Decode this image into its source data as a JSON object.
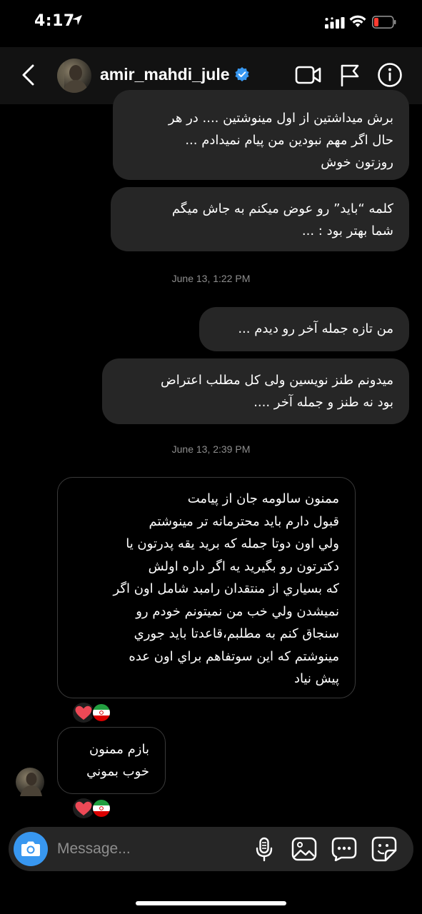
{
  "status_bar": {
    "time": "4:17"
  },
  "header": {
    "username": "amir_mahdi_jule"
  },
  "messages": [
    {
      "lines": [
        "برش میداشتین از اول مینوشتین .... در هر",
        "حال اگر مهم نبودین من پیام نمیدادم ...",
        "روزتون خوش"
      ]
    },
    {
      "lines": [
        "کلمه “باید” رو عوض میکنم به جاش میگم",
        "شما بهتر بود : ..."
      ]
    },
    {
      "lines": [
        "من تازه جمله آخر رو دیدم ..."
      ]
    },
    {
      "lines": [
        "میدونم طنز نویسین ولی کل مطلب اعتراض",
        "بود نه طنز و جمله آخر ...."
      ]
    },
    {
      "lines": [
        "ممنون سالومه جان از پیامت",
        "قبول دارم باید محترمانه تر مینوشتم",
        "ولي اون دوتا جمله که برید یقه پدرتون یا",
        "دکترتون رو بگیرید یه اگر داره اولش",
        "که بسياري از منتقدان رامبد شامل اون اگر",
        "نميشدن ولي خب من نميتونم خودم رو",
        "سنجاق کنم به مطلبم،قاعدتا بايد جوري",
        "مينوشتم که اين سوتفاهم براي اون عده",
        "پيش نياد"
      ]
    },
    {
      "lines": [
        "بازم ممنون",
        "خوب بموني"
      ]
    }
  ],
  "timestamps": [
    "June 13, 1:22 PM",
    "June 13, 2:39 PM"
  ],
  "composer": {
    "placeholder": "Message..."
  },
  "colors": {
    "accent": "#3897f0",
    "verified": "#3897f0",
    "battery_low": "#ff3b30",
    "bubble_out": "#262626",
    "heart": "#ed4956"
  },
  "icons": [
    "back-arrow-icon",
    "verified-badge-icon",
    "video-call-icon",
    "flag-icon",
    "info-icon",
    "camera-icon",
    "microphone-icon",
    "gallery-icon",
    "more-icon",
    "sticker-icon",
    "heart-reaction-icon",
    "iran-flag-reaction-icon"
  ]
}
